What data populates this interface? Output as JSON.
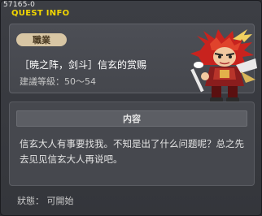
{
  "window": {
    "quest_id": "57165-0",
    "title": "QUEST INFO"
  },
  "quest": {
    "job_label": "職業",
    "title": "［暁之阵，剑斗］信玄的赏赐",
    "level_range": "建議等級：50～54",
    "npc_icon": "red-armored-warrior-npc"
  },
  "content": {
    "header": "内容",
    "text": "信玄大人有事要找我。不知是出了什么问题呢？总之先去见见信玄大人再说吧。"
  },
  "status": "狀態：  可開始",
  "colors": {
    "title_yellow": "#f2d600",
    "badge_bg": "#d8c6a4",
    "panel_bg": "#46484e"
  }
}
